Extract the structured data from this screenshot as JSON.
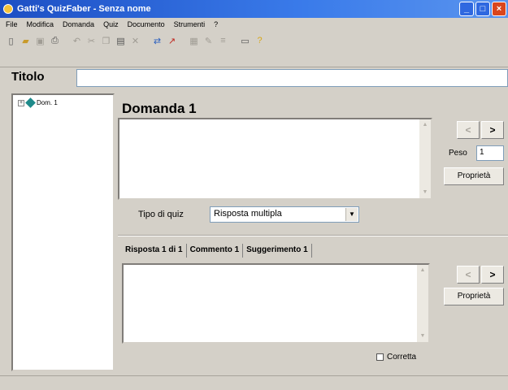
{
  "window": {
    "title": "Gatti's QuizFaber - Senza nome",
    "buttons": [
      "_",
      "□",
      "×"
    ]
  },
  "menu": [
    "File",
    "Modifica",
    "Domanda",
    "Quiz",
    "Documento",
    "Strumenti",
    "?"
  ],
  "toolbar": {
    "icons": [
      "new-doc-icon",
      "open-folder-icon",
      "save-icon",
      "print-icon",
      "undo-icon",
      "cut-icon",
      "copy-icon",
      "paste-icon",
      "delete-icon",
      "insert-icon",
      "link-icon",
      "table-icon",
      "edit-icon",
      "list-icon",
      "preview-icon",
      "help-icon"
    ]
  },
  "titolo": {
    "label": "Titolo",
    "value": ""
  },
  "tree": {
    "node_label": "Dom. 1"
  },
  "question": {
    "heading": "Domanda 1",
    "text": "",
    "peso_label": "Peso",
    "peso_value": "1",
    "properties_label": "Proprietà",
    "tipo_label": "Tipo di quiz",
    "tipo_value": "Risposta multipla"
  },
  "answer": {
    "tabs": [
      "Risposta 1 di 1",
      "Commento 1",
      "Suggerimento 1"
    ],
    "text": "",
    "properties_label": "Proprietà",
    "corretta_label": "Corretta"
  },
  "nav": {
    "prev": "<",
    "next": ">"
  }
}
